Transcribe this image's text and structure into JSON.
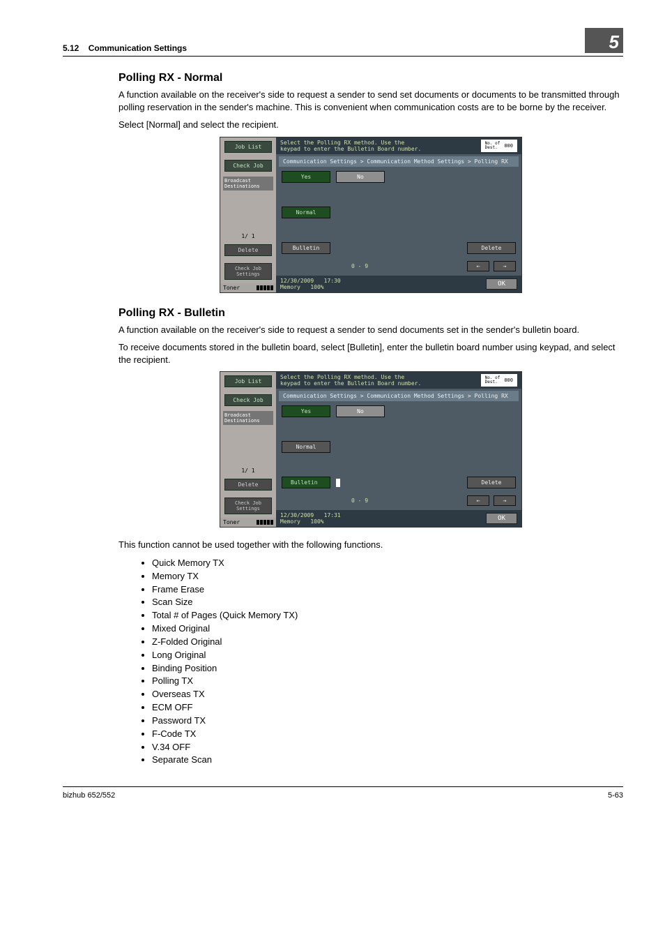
{
  "header": {
    "section_number": "5.12",
    "section_title": "Communication Settings",
    "chapter_number": "5"
  },
  "section1": {
    "heading": "Polling RX - Normal",
    "para1": "A function available on the receiver's side to request a sender to send set documents or documents to be transmitted through polling reservation in the sender's machine. This is convenient when communication costs are to be borne by the receiver.",
    "para2": "Select [Normal] and select the recipient."
  },
  "screenshot1": {
    "left": {
      "job_list": "Job List",
      "check_job": "Check Job",
      "broadcast": "Broadcast\nDestinations",
      "page": "1/ 1",
      "delete": "Delete",
      "check_settings": "Check Job\nSettings",
      "toner": "Toner"
    },
    "top_hint": "Select the Polling RX method. Use the\nkeypad to enter the Bulletin Board number.",
    "dest_label": "No. of\nDest.",
    "dest_count": "000",
    "breadcrumb": "Communication Settings > Communication Method Settings > Polling RX",
    "yes": "Yes",
    "no": "No",
    "normal": "Normal",
    "bulletin": "Bulletin",
    "delete_btn": "Delete",
    "range": "0 - 9",
    "arrow_left": "←",
    "arrow_right": "→",
    "date": "12/30/2009",
    "time": "17:30",
    "memory": "Memory",
    "memory_pct": "100%",
    "ok": "OK"
  },
  "section2": {
    "heading": "Polling RX - Bulletin",
    "para1": "A function available on the receiver's side to request a sender to send documents set in the sender's bulletin board.",
    "para2": "To receive documents stored in the bulletin board, select [Bulletin], enter the bulletin board number using keypad, and select the recipient."
  },
  "screenshot2": {
    "left": {
      "job_list": "Job List",
      "check_job": "Check Job",
      "broadcast": "Broadcast\nDestinations",
      "page": "1/ 1",
      "delete": "Delete",
      "check_settings": "Check Job\nSettings",
      "toner": "Toner"
    },
    "top_hint": "Select the Polling RX method. Use the\nkeypad to enter the Bulletin Board number.",
    "dest_label": "No. of\nDest.",
    "dest_count": "000",
    "breadcrumb": "Communication Settings > Communication Method Settings > Polling RX",
    "yes": "Yes",
    "no": "No",
    "normal": "Normal",
    "bulletin": "Bulletin",
    "delete_btn": "Delete",
    "range": "0 - 9",
    "arrow_left": "←",
    "arrow_right": "→",
    "date": "12/30/2009",
    "time": "17:31",
    "memory": "Memory",
    "memory_pct": "100%",
    "ok": "OK"
  },
  "after2": {
    "intro": "This function cannot be used together with the following functions.",
    "items": [
      "Quick Memory TX",
      "Memory TX",
      "Frame Erase",
      "Scan Size",
      "Total # of Pages (Quick Memory TX)",
      "Mixed Original",
      "Z-Folded Original",
      "Long Original",
      "Binding Position",
      "Polling TX",
      "Overseas TX",
      "ECM OFF",
      "Password TX",
      "F-Code TX",
      "V.34 OFF",
      "Separate Scan"
    ]
  },
  "footer": {
    "left": "bizhub 652/552",
    "right": "5-63"
  }
}
